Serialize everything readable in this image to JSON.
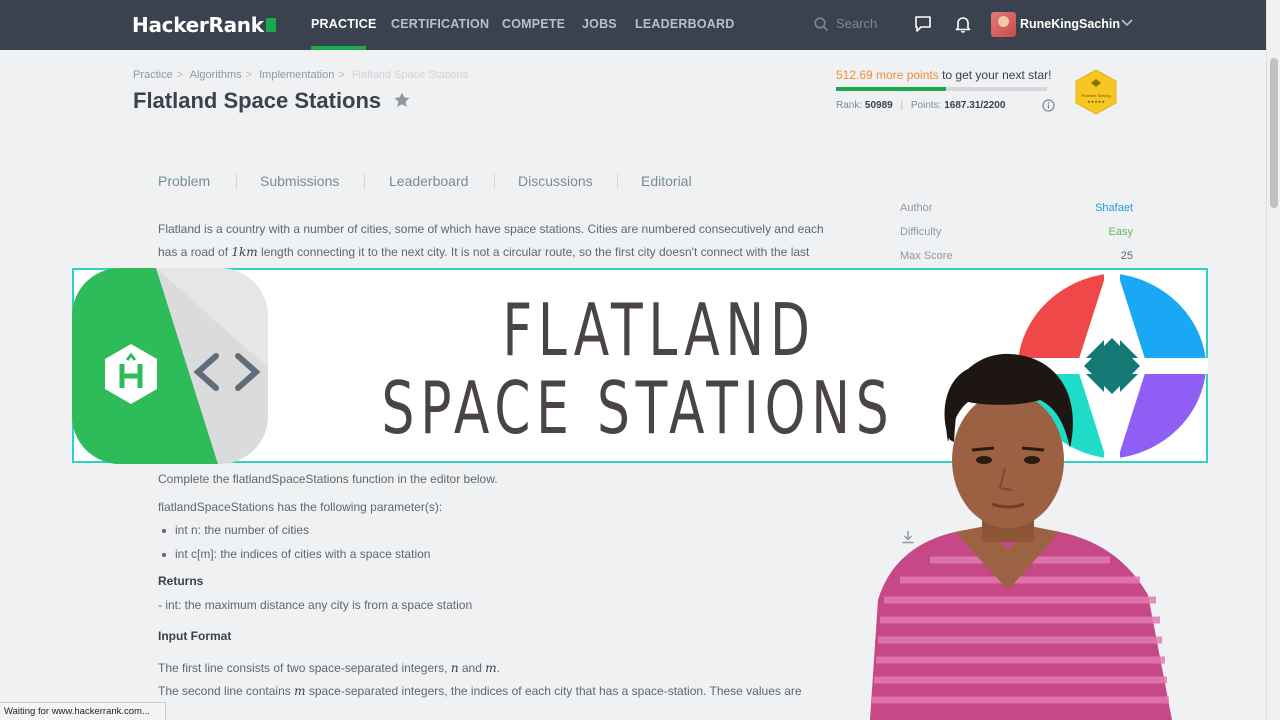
{
  "header": {
    "logo": "HackerRank",
    "nav": [
      "PRACTICE",
      "CERTIFICATION",
      "COMPETE",
      "JOBS",
      "LEADERBOARD"
    ],
    "active_nav": "PRACTICE",
    "search_placeholder": "Search",
    "username": "RuneKingSachin"
  },
  "breadcrumb": [
    "Practice",
    "Algorithms",
    "Implementation",
    "Flatland Space Stations"
  ],
  "title": "Flatland Space Stations",
  "progress": {
    "points_needed": "512.69 more points",
    "points_suffix": " to get your next star!",
    "fill_fraction": 0.52,
    "rank_label": "Rank:",
    "rank": "50989",
    "points_label": "Points:",
    "points": "1687.31/2200",
    "badge_label": "Problem Solving"
  },
  "tabs": [
    "Problem",
    "Submissions",
    "Leaderboard",
    "Discussions",
    "Editorial"
  ],
  "problem": {
    "line1": "Flatland is a country with a number of cities, some of which have space stations. Cities are numbered consecutively and each",
    "line2_pre": "has a road of ",
    "line2_math": "1km",
    "line2_post": " length connecting it to the next city. It is not a circular route, so the first city doesn't connect with the last",
    "complete": "Complete the flatlandSpaceStations function in the editor below.",
    "params_intro": "flatlandSpaceStations has the following parameter(s):",
    "params": [
      "int n: the number of cities",
      "int c[m]: the indices of cities with a space station"
    ],
    "returns_heading": "Returns",
    "returns": "- int: the maximum distance any city is from a space station",
    "input_heading": "Input Format",
    "input1_pre": "The first line consists of two space-separated integers, ",
    "input1_n": "n",
    "input1_mid": " and ",
    "input1_m": "m",
    "input1_end": ".",
    "input2_pre": "The second line contains ",
    "input2_m": "m",
    "input2_post": " space-separated integers, the indices of each city that has a space-station. These values are"
  },
  "sidebar": {
    "author_label": "Author",
    "author": "Shafaet",
    "difficulty_label": "Difficulty",
    "difficulty": "Easy",
    "max_score_label": "Max Score",
    "max_score": "25"
  },
  "banner": {
    "line1": "FLATLAND",
    "line2": "SPACE  STATIONS"
  },
  "statusbar": "Waiting for www.hackerrank.com...",
  "colors": {
    "nav_bg": "#39424e",
    "accent_green": "#1ba94c",
    "link_blue": "#1ba0d8",
    "banner_border": "#2ed1c4",
    "easy_green": "#5cb85c"
  }
}
